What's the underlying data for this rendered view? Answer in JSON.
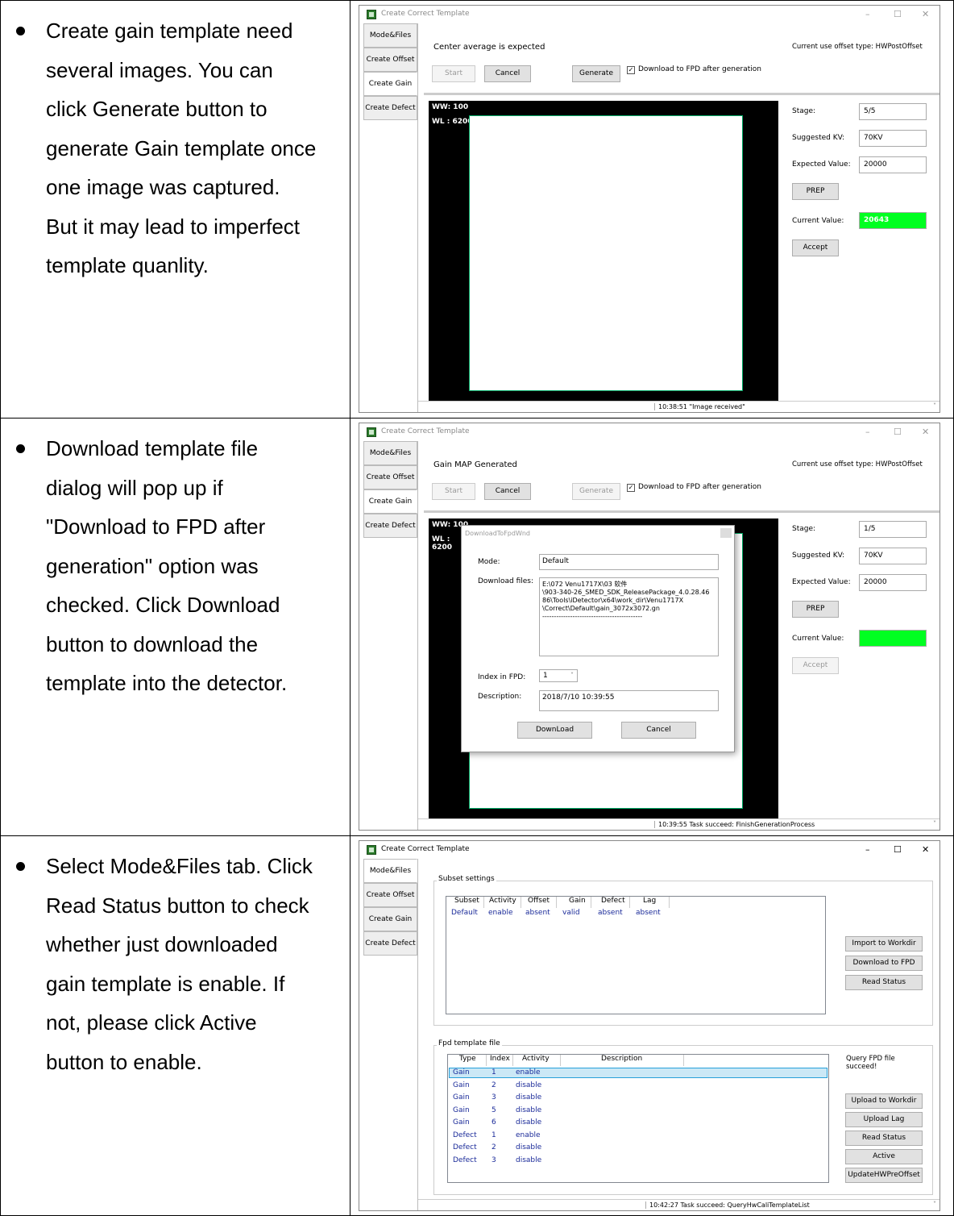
{
  "rows": [
    {
      "bullet_text": "Create gain template need several images. You can click Generate button to generate Gain template once one image was captured. But it may lead to imperfect template quanlity.",
      "lines": [
        "Create gain template need",
        "several images. You can",
        "click Generate button to",
        "generate Gain template once",
        "one image was captured.",
        "But it may lead to imperfect",
        "template quanlity."
      ]
    },
    {
      "lines": [
        "Download template file",
        "dialog will pop up if",
        "\"Download to FPD after",
        "generation\" option was",
        "checked. Click Download",
        "button to download the",
        "template into the detector."
      ]
    },
    {
      "lines": [
        "Select Mode&Files tab. Click",
        "Read Status button to check",
        "whether just downloaded",
        "gain template is enable. If",
        "not, please click Active",
        "button to enable."
      ]
    }
  ],
  "window": {
    "title": "Create Correct Template",
    "tabs": [
      "Mode&Files",
      "Create Offset",
      "Create Gain",
      "Create Defect"
    ],
    "offset_type": "Current use offset type: HWPostOffset",
    "start": "Start",
    "cancel": "Cancel",
    "generate": "Generate",
    "download_check": "Download to FPD after generation",
    "check_mark": "✓",
    "ww": "WW:  100",
    "wl": "WL :  6200",
    "stage_label": "Stage:",
    "kv_label": "Suggested KV:",
    "kv_value": "70KV",
    "expected_label": "Expected Value:",
    "expected_value": "20000",
    "prep": "PREP",
    "current_label": "Current Value:",
    "accept": "Accept",
    "minimize": "–",
    "maximize": "☐",
    "close": "✕",
    "chevron": "˅"
  },
  "shot1": {
    "status_msg": "Center average is expected",
    "stage_value": "5/5",
    "current_value": "20643",
    "status_bar": "10:38:51 \"Image received\""
  },
  "shot2": {
    "status_msg": "Gain MAP Generated",
    "stage_value": "1/5",
    "status_bar": "10:39:55 Task succeed: FinishGenerationProcess",
    "dialog": {
      "title": "DownloadToFpdWnd",
      "mode_label": "Mode:",
      "mode_value": "Default",
      "files_label": "Download files:",
      "files_value": "E:\\072 Venu1717X\\03 软件\n\\903-340-26_SMED_SDK_ReleasePackage_4.0.28.46\n86\\Tools\\iDetector\\x64\\work_dir\\Venu1717X\n\\Correct\\Default\\gain_3072x3072.gn\n-------------------------------------------",
      "index_label": "Index in FPD:",
      "index_value": "1",
      "desc_label": "Description:",
      "desc_value": "2018/7/10 10:39:55",
      "download_btn": "DownLoad",
      "cancel_btn": "Cancel"
    }
  },
  "shot3": {
    "subset_title": "Subset settings",
    "subset_headers": [
      "Subset",
      "Activity",
      "Offset",
      "Gain",
      "Defect",
      "Lag"
    ],
    "subset_row": [
      "Default",
      "enable",
      "absent",
      "valid",
      "absent",
      "absent"
    ],
    "import_btn": "Import to Workdir",
    "download_btn": "Download to FPD",
    "read_status_btn": "Read Status",
    "fpd_title": "Fpd template file",
    "fpd_headers": [
      "Type",
      "Index",
      "Activity",
      "Description"
    ],
    "fpd_rows": [
      [
        "Gain",
        "1",
        "enable"
      ],
      [
        "Gain",
        "2",
        "disable"
      ],
      [
        "Gain",
        "3",
        "disable"
      ],
      [
        "Gain",
        "5",
        "disable"
      ],
      [
        "Gain",
        "6",
        "disable"
      ],
      [
        "Defect",
        "1",
        "enable"
      ],
      [
        "Defect",
        "2",
        "disable"
      ],
      [
        "Defect",
        "3",
        "disable"
      ]
    ],
    "query_msg": "Query FPD file succeed!",
    "upload_workdir_btn": "Upload to Workdir",
    "upload_lag_btn": "Upload Lag",
    "read_status2_btn": "Read Status",
    "active_btn": "Active",
    "update_btn": "UpdateHWPreOffset",
    "status_bar": "10:42:27 Task succeed: QueryHwCaliTemplateList"
  }
}
